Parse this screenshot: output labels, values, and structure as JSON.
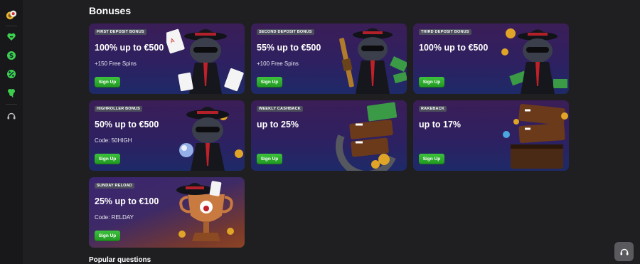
{
  "page": {
    "title": "Bonuses",
    "faq_title": "Popular questions"
  },
  "sidebar": {
    "items": [
      {
        "icon": "casino-chips-icon"
      },
      {
        "icon": "heart-icon"
      },
      {
        "icon": "dollar-coin-icon"
      },
      {
        "icon": "percent-icon"
      },
      {
        "icon": "clover-icon"
      },
      {
        "icon": "headset-icon"
      }
    ]
  },
  "bonuses": [
    {
      "badge": "First Deposit Bonus",
      "headline": "100% up to €500",
      "sub": "+150 Free Spins",
      "cta": "Sign Up",
      "art": "raccoon-cards"
    },
    {
      "badge": "Second Deposit Bonus",
      "headline": "55% up to €500",
      "sub": "+100 Free Spins",
      "cta": "Sign Up",
      "art": "raccoon-gun"
    },
    {
      "badge": "Third Deposit Bonus",
      "headline": "100% up to €500",
      "sub": "",
      "cta": "Sign Up",
      "art": "raccoon-coins"
    },
    {
      "badge": "Highroller Bonus",
      "headline": "50% up to €500",
      "sub": "Code: 50HIGH",
      "cta": "Sign Up",
      "art": "raccoon-orb"
    },
    {
      "badge": "Weekly Cashback",
      "headline": "up to 25%",
      "sub": "",
      "cta": "Sign Up",
      "art": "cashback-sign"
    },
    {
      "badge": "Rakeback",
      "headline": "up to 17%",
      "sub": "",
      "cta": "Sign Up",
      "art": "rakeback-sign"
    },
    {
      "badge": "Sunday Reload",
      "headline": "25% up to €100",
      "sub": "Code: RELDAY",
      "cta": "Sign Up",
      "art": "trophy-hat"
    }
  ],
  "support": {
    "icon": "headset-icon"
  },
  "colors": {
    "background": "#1f1f22",
    "sidebar": "#18181a",
    "accent_green": "#2fae2f",
    "sidebar_icon_green": "#3ccf4e",
    "badge": "#4b4d5c",
    "gold": "#e0a526",
    "tie_red": "#c0202a"
  }
}
